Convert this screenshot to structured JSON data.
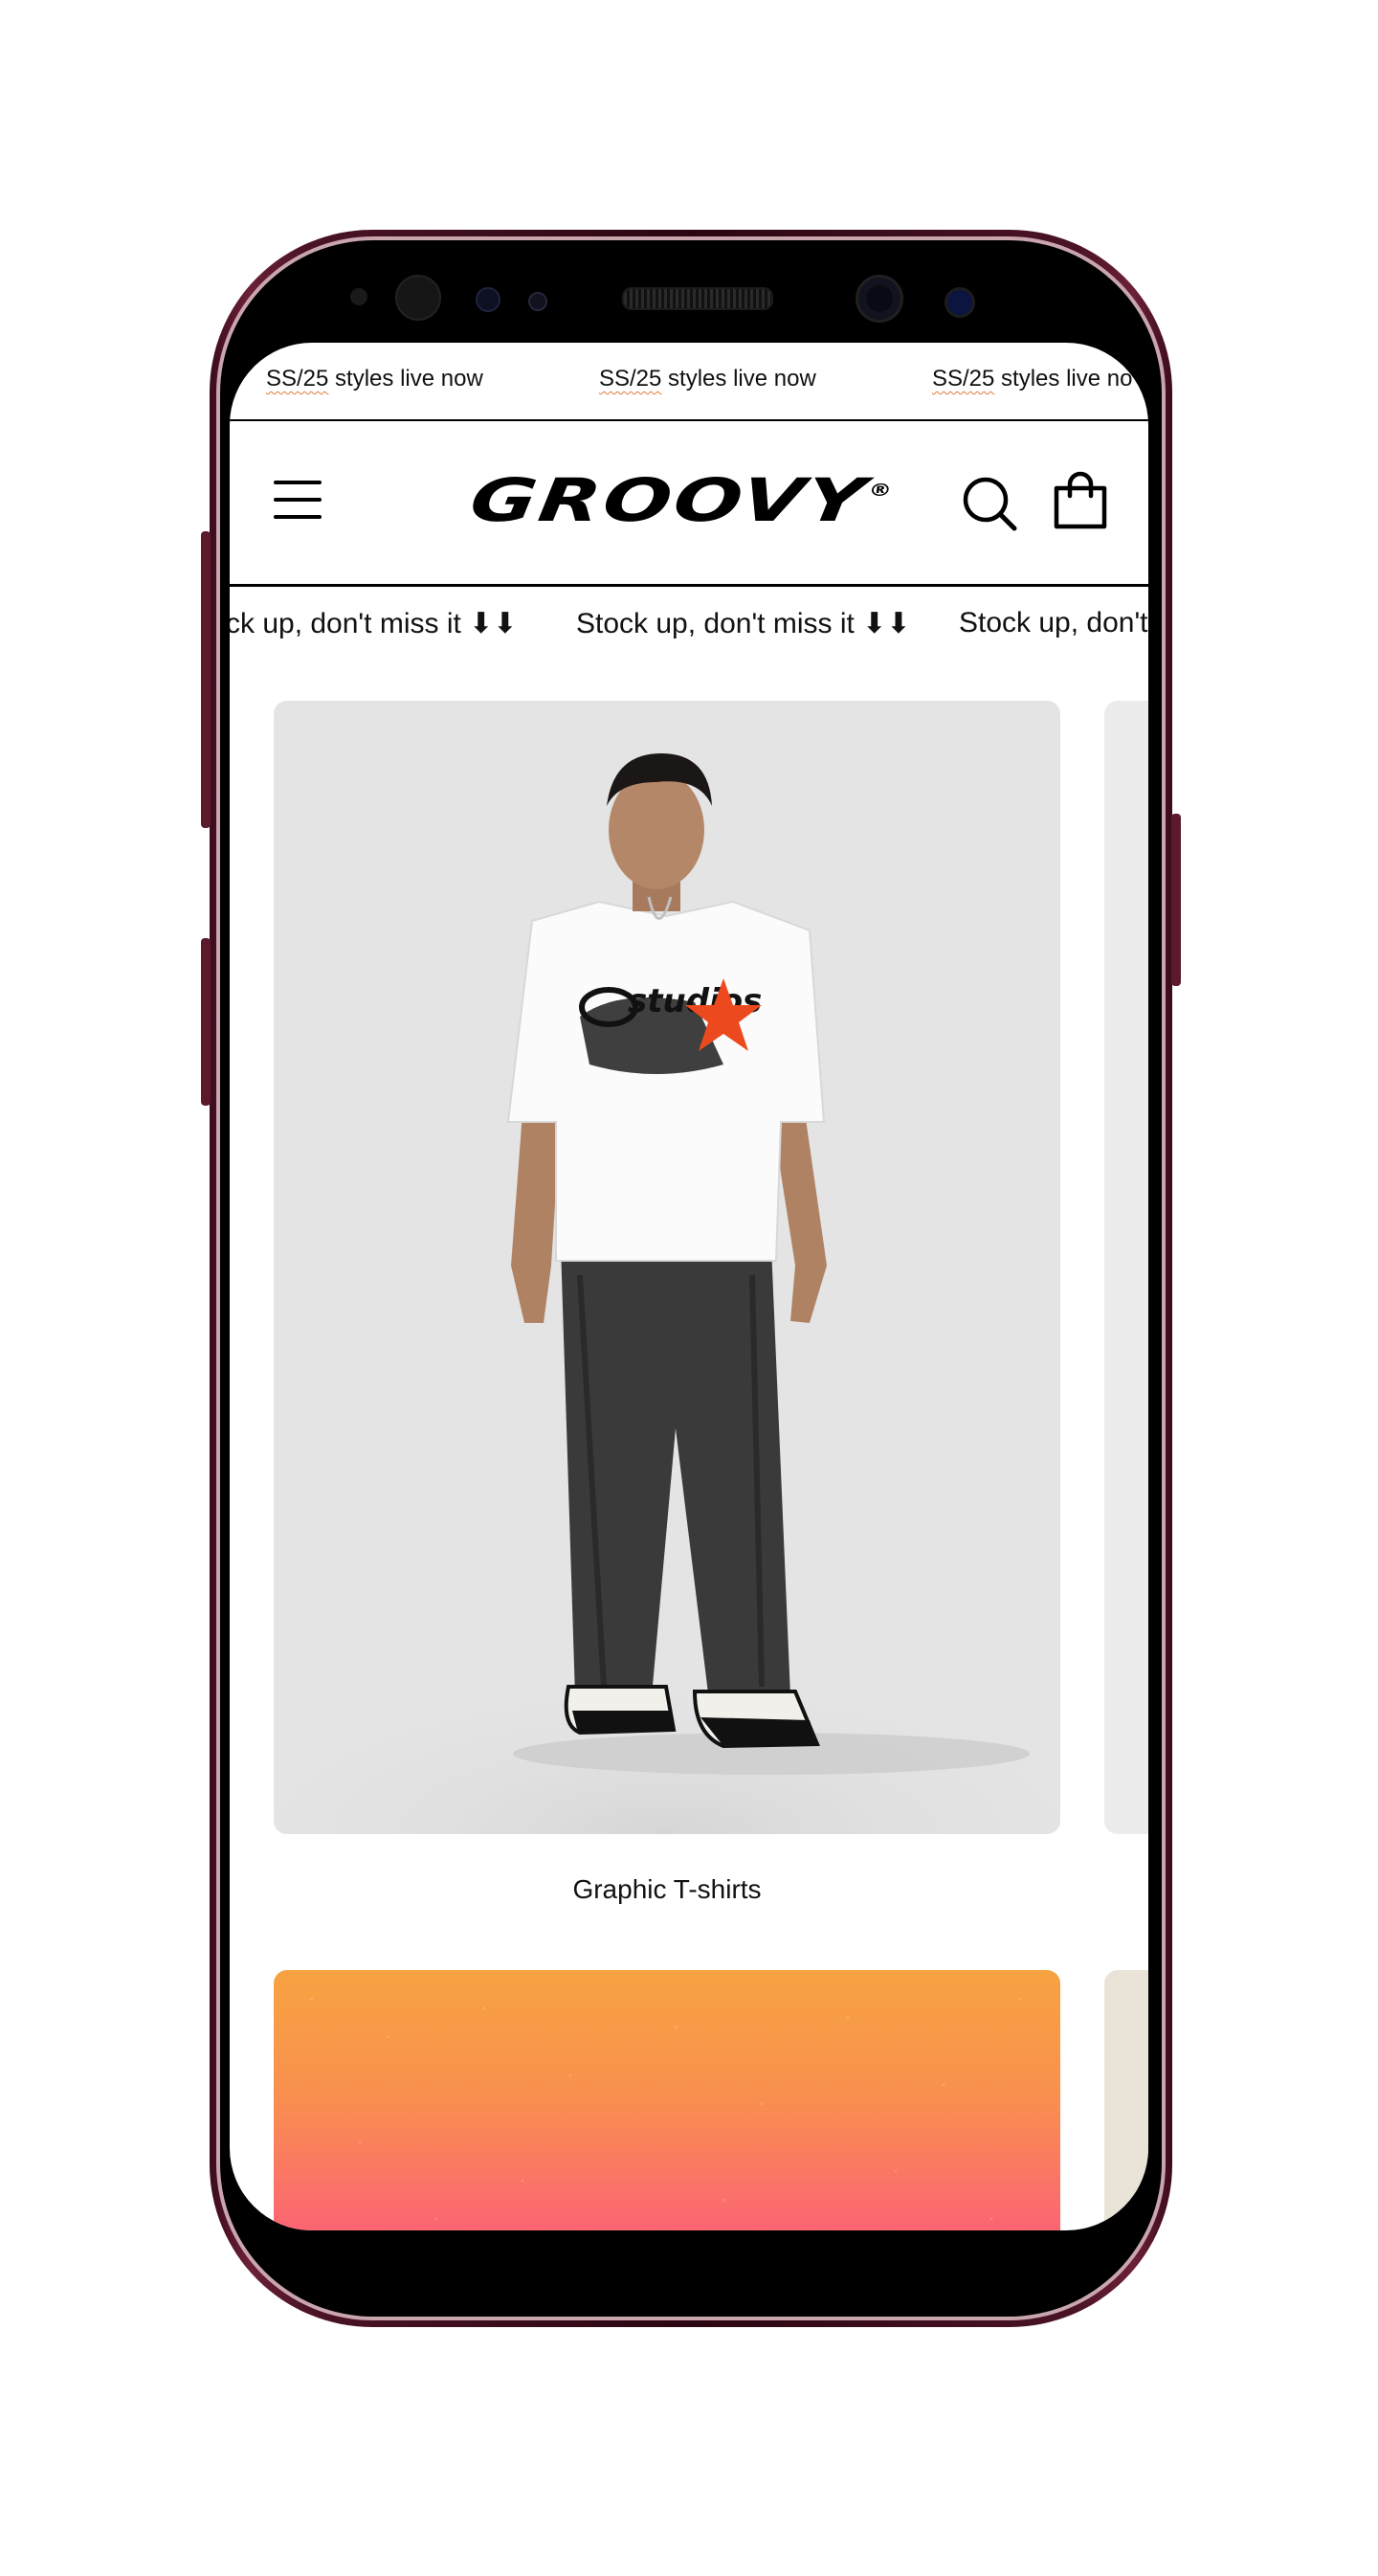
{
  "announcement": {
    "items": [
      {
        "ss": "SS/25",
        "rest": " styles live now"
      },
      {
        "ss": "SS/25",
        "rest": " styles live now"
      },
      {
        "ss": "SS/25",
        "rest": " styles live no"
      }
    ]
  },
  "header": {
    "logo": "GROOVY",
    "logo_mark": "®"
  },
  "ticker": {
    "items": [
      "ck up, don't miss it ⬇⬇",
      "Stock up, don't miss it ⬇⬇",
      "Stock up, don't"
    ]
  },
  "collections": [
    {
      "label": "Graphic T-shirts",
      "image": "model-white-graphic-tee-photo"
    },
    {
      "label": "",
      "image": "gradient-banner"
    }
  ],
  "colors": {
    "frame": "#4a1326",
    "card_bg": "#e3e3e3",
    "gradient_top": "#f7a341",
    "gradient_bottom": "#fc5c78"
  }
}
